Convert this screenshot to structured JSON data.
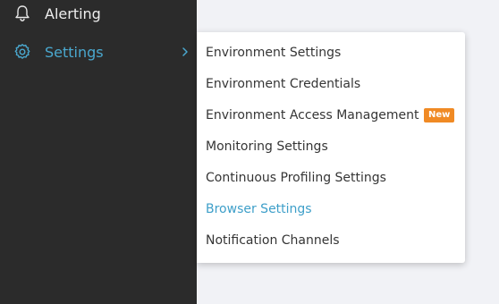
{
  "sidebar": {
    "items": [
      {
        "label": "Alerting",
        "icon": "bell-icon"
      },
      {
        "label": "Settings",
        "icon": "gear-icon",
        "active": true
      }
    ]
  },
  "settings_menu": {
    "items": [
      {
        "label": "Environment Settings"
      },
      {
        "label": "Environment Credentials"
      },
      {
        "label": "Environment Access Management",
        "badge": "New"
      },
      {
        "label": "Monitoring Settings"
      },
      {
        "label": "Continuous Profiling Settings"
      },
      {
        "label": "Browser Settings",
        "active": true
      },
      {
        "label": "Notification Channels"
      }
    ]
  },
  "colors": {
    "sidebar_bg": "#2b2b2b",
    "accent": "#4aa8cf",
    "badge": "#f08a24",
    "page_bg": "#f1f2f6"
  }
}
